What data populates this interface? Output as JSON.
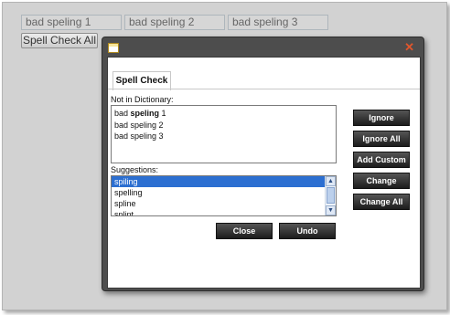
{
  "fields": [
    {
      "value": "bad speling 1"
    },
    {
      "value": "bad speling 2"
    },
    {
      "value": "bad speling 3"
    }
  ],
  "spell_check_all_label": "Spell Check All",
  "dialog": {
    "icon": "window-app-icon",
    "close_icon": "close-x-icon",
    "close_glyph": "✕",
    "tab_label": "Spell Check",
    "not_in_dictionary_label": "Not in Dictionary:",
    "not_in_dictionary_items": [
      {
        "prefix": "bad ",
        "word": "speling",
        "suffix": " 1"
      },
      {
        "text": "bad speling 2"
      },
      {
        "text": "bad speling 3"
      }
    ],
    "suggestions_label": "Suggestions:",
    "suggestions": [
      "spiling",
      "spelling",
      "spline",
      "splint"
    ],
    "selected_suggestion": "spiling",
    "buttons": {
      "ignore": "Ignore",
      "ignore_all": "Ignore All",
      "add_custom": "Add Custom",
      "change": "Change",
      "change_all": "Change All",
      "close": "Close",
      "undo": "Undo"
    },
    "scroll_up_glyph": "▲",
    "scroll_down_glyph": "▼"
  },
  "colors": {
    "page_bg": "#d2d2d2",
    "dialog_frame": "#4d4d4d",
    "selection": "#2c6fd1",
    "close_x": "#e0562c",
    "button_dark": "#1c1c1c"
  }
}
